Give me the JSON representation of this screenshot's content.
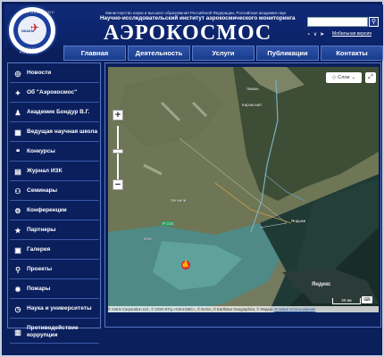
{
  "header": {
    "ministry_line": "Министерство науки и высшего образования Российской Федерации, Российская академия наук",
    "institute_line": "Научно-исследовательский институт аэрокосмического мониторинга",
    "brand": "АЭРОКОСМОС",
    "mobile_link": "Мобильная версия",
    "logo_text_top": "АЭРОКОСМОС",
    "logo_text_bottom": "МОСКВА РОССИЯ",
    "logo_mark": "NIIAKM"
  },
  "nav": [
    {
      "label": "Главная"
    },
    {
      "label": "Деятельность"
    },
    {
      "label": "Услуги"
    },
    {
      "label": "Публикации"
    },
    {
      "label": "Контакты"
    }
  ],
  "sidebar": {
    "items": [
      {
        "label": "Новости",
        "icon": "globe-icon"
      },
      {
        "label": "Об \"Аэрокосмос\"",
        "icon": "satellite-icon"
      },
      {
        "label": "Академик Бондур В.Г.",
        "icon": "person-icon"
      },
      {
        "label": "Ведущая научная школа",
        "icon": "book-icon"
      },
      {
        "label": "Конкурсы",
        "icon": "chat-icon"
      },
      {
        "label": "Журнал ИЗК",
        "icon": "journal-icon"
      },
      {
        "label": "Семинары",
        "icon": "seminar-icon"
      },
      {
        "label": "Конференции",
        "icon": "conference-icon"
      },
      {
        "label": "Партнеры",
        "icon": "star-icon"
      },
      {
        "label": "Галерея",
        "icon": "image-icon"
      },
      {
        "label": "Проекты",
        "icon": "search-icon"
      },
      {
        "label": "Пожары",
        "icon": "fire-icon"
      },
      {
        "label": "Наука и университеты",
        "icon": "clock-icon"
      },
      {
        "label": "Противодействие коррупции",
        "icon": "document-icon"
      }
    ]
  },
  "map": {
    "layers_label": "Слои",
    "scale_label": "20 км",
    "watermark": "Яндекс",
    "attribution": "© Antrix Corporation Ltd., © ООО ИТЦ «СКАНЭКС», © NASA, © Earthstar Geographics, © Яндекс",
    "attribution_link": "Условия использования",
    "zoom_in": "+",
    "zoom_out": "−",
    "road_label": "Р-216",
    "places": [
      "Лиман",
      "Зензели",
      "Яндыки",
      "Оля",
      "Кировский"
    ]
  }
}
